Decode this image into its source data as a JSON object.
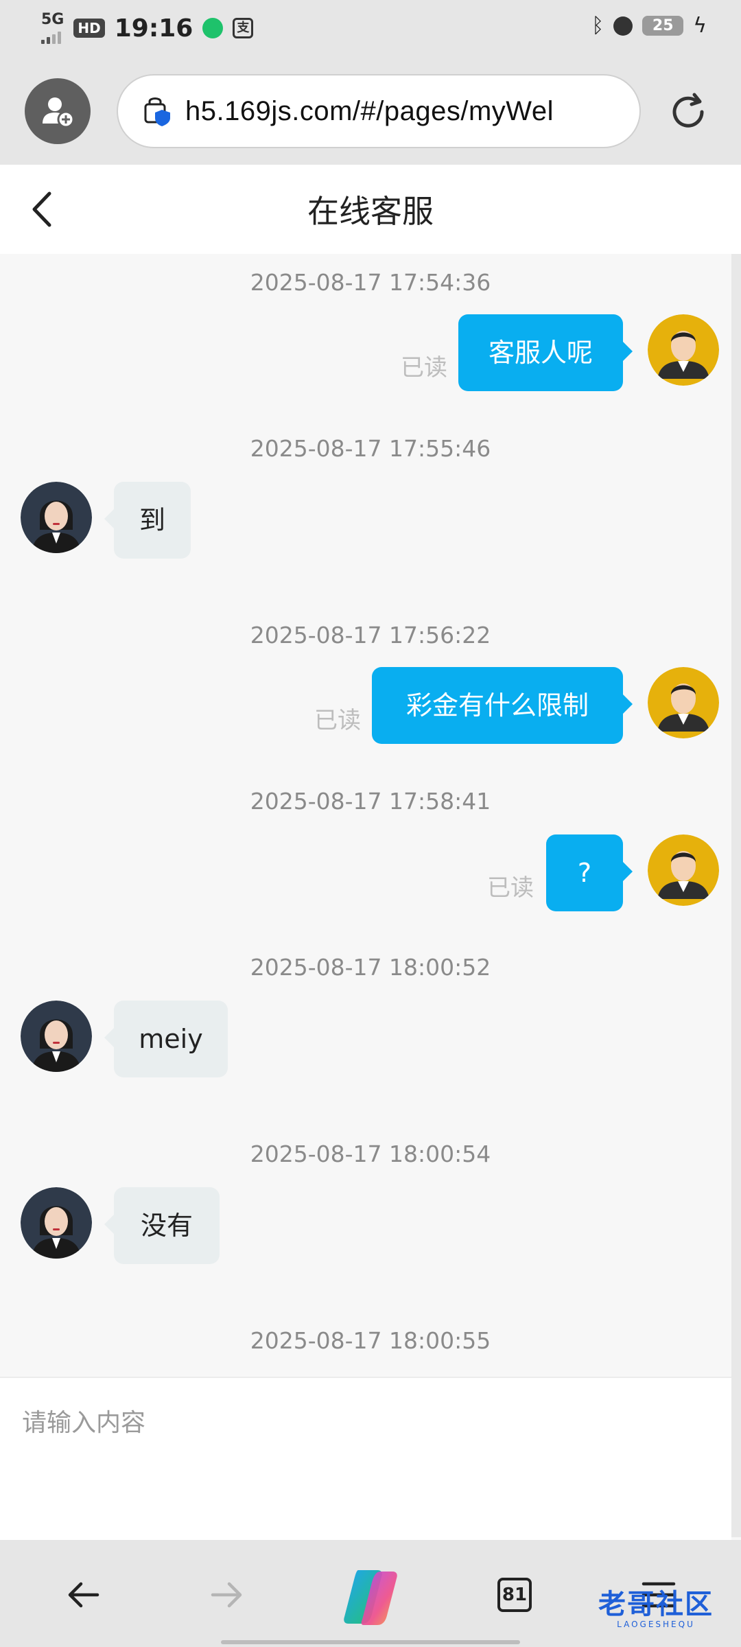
{
  "status_bar": {
    "network": "5G",
    "hd": "HD",
    "time": "19:16",
    "battery": "25"
  },
  "browser": {
    "url": "h5.169js.com/#/pages/myWel"
  },
  "header": {
    "title": "在线客服"
  },
  "messages": [
    {
      "timestamp": "2025-08-17 17:54:36",
      "from": "user",
      "text": "客服人呢",
      "status": "已读"
    },
    {
      "timestamp": "2025-08-17 17:55:46",
      "from": "agent",
      "text": "到"
    },
    {
      "timestamp": "2025-08-17 17:56:22",
      "from": "user",
      "text": "彩金有什么限制",
      "status": "已读"
    },
    {
      "timestamp": "2025-08-17 17:58:41",
      "from": "user",
      "text": "?",
      "status": "已读"
    },
    {
      "timestamp": "2025-08-17 18:00:52",
      "from": "agent",
      "text": "meiy"
    },
    {
      "timestamp": "2025-08-17 18:00:54",
      "from": "agent",
      "text": "没有"
    },
    {
      "timestamp": "2025-08-17 18:00:55"
    }
  ],
  "input": {
    "placeholder": "请输入内容"
  },
  "bottom_nav": {
    "tabs_count": "81",
    "watermark_text": "老哥社区",
    "watermark_sub": "LAOGESHEQU"
  },
  "colors": {
    "user_bubble": "#09aef0",
    "agent_bubble": "#e9eeef",
    "background": "#f7f7f7"
  }
}
